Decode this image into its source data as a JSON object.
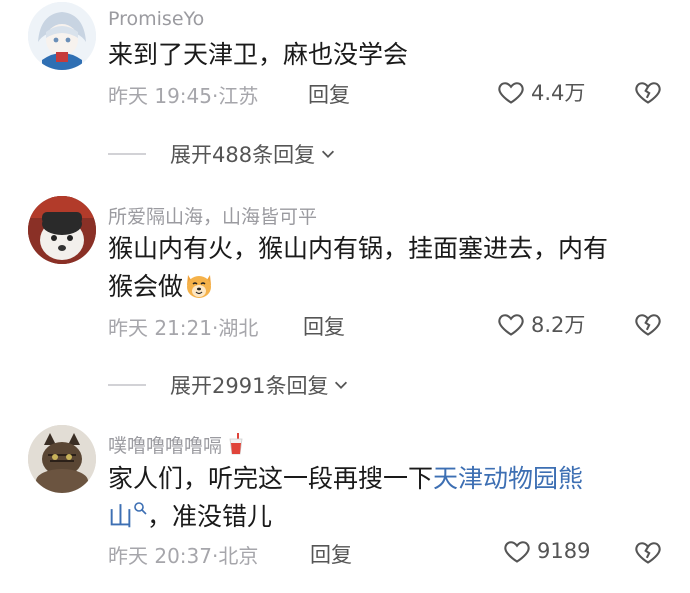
{
  "comments": [
    {
      "username": "PromiseYo",
      "content": "来到了天津卫，麻也没学会",
      "time": "昨天 19:45",
      "location": "江苏",
      "reply_label": "回复",
      "likes": "4.4万",
      "avatar_icon": "anime-avatar",
      "expand_label": "展开488条回复"
    },
    {
      "username": "所爱隔山海，山海皆可平",
      "content_line1": "猴山内有火，猴山内有锅，挂面塞进去，内有",
      "content_line2": "猴会做",
      "content_emoji": "dog-face-emoji",
      "time": "昨天 21:21",
      "location": "湖北",
      "reply_label": "回复",
      "likes": "8.2万",
      "avatar_icon": "dog-avatar",
      "expand_label": "展开2991条回复"
    },
    {
      "username": "噗噜噜噜噜嗝",
      "username_icon": "cup-emoji",
      "content_prefix": "家人们，听完这一段再搜一下",
      "content_link": "天津动物园熊",
      "content_link2": "山",
      "content_suffix": "，准没错儿",
      "time": "昨天 20:37",
      "location": "北京",
      "reply_label": "回复",
      "likes": "9189",
      "avatar_icon": "cat-avatar"
    }
  ],
  "separator": "·",
  "colors": {
    "link": "#3d6fb3",
    "muted": "#a6a6ab",
    "text": "#1a1a1a"
  }
}
